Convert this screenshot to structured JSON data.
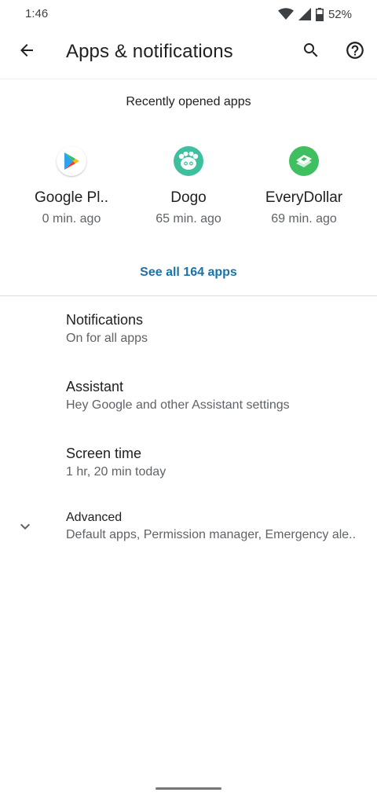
{
  "status_bar": {
    "time": "1:46",
    "battery": "52%",
    "icons": [
      "wifi-icon",
      "cell-signal-icon",
      "battery-icon"
    ]
  },
  "app_bar": {
    "title": "Apps & notifications",
    "icons": [
      "arrow-back-icon",
      "search-icon",
      "help-icon"
    ]
  },
  "recent": {
    "header": "Recently opened apps",
    "apps": [
      {
        "name": "Google Pl..",
        "time": "0 min. ago",
        "icon": "play-store-icon"
      },
      {
        "name": "Dogo",
        "time": "65 min. ago",
        "icon": "dogo-icon"
      },
      {
        "name": "EveryDollar",
        "time": "69 min. ago",
        "icon": "everydollar-icon"
      }
    ],
    "see_all": "See all 164 apps"
  },
  "prefs": [
    {
      "title": "Notifications",
      "summary": "On for all apps"
    },
    {
      "title": "Assistant",
      "summary": "Hey Google and other Assistant settings"
    },
    {
      "title": "Screen time",
      "summary": "1 hr, 20 min today"
    },
    {
      "title": "Advanced",
      "summary": "Default apps, Permission manager, Emergency ale..",
      "icon": "chevron-down-icon"
    }
  ],
  "colors": {
    "accent": "#1a73a8",
    "dogo": "#3fbf9f",
    "everydollar": "#3fbf5f"
  }
}
